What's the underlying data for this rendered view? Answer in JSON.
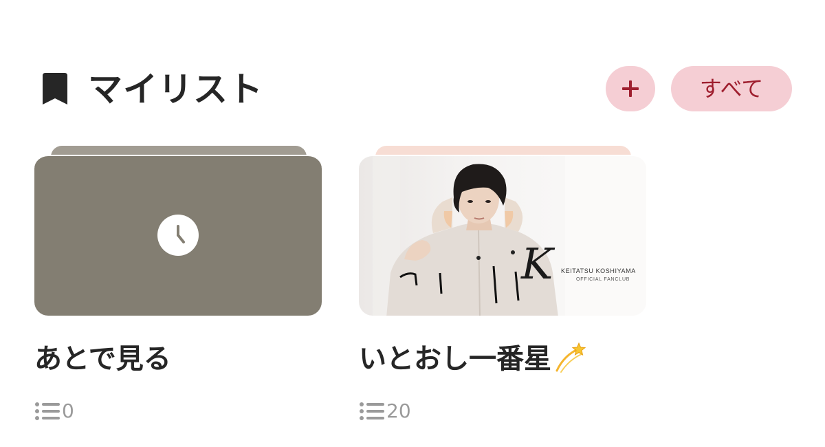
{
  "header": {
    "title": "マイリスト",
    "icon": "bookmark-icon",
    "add_button_icon": "plus-icon",
    "all_button_label": "すべて"
  },
  "colors": {
    "pill_background": "#f5ced4",
    "pill_text": "#9f1f2f",
    "watch_later_thumb": "#837e72"
  },
  "lists": [
    {
      "title": "あとで見る",
      "thumbnail_icon": "clock-icon",
      "count": "0"
    },
    {
      "title": "いとおし一番星",
      "title_emoji": "dizzy-star-icon",
      "count": "20",
      "banner": {
        "logo_letter": "K",
        "line1": "KEITATSU KOSHIYAMA",
        "line2": "OFFICIAL FANCLUB"
      }
    }
  ]
}
